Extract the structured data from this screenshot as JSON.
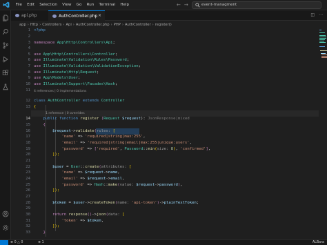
{
  "menu": [
    "File",
    "Edit",
    "Selection",
    "View",
    "Go",
    "Run",
    "Terminal",
    "Help"
  ],
  "search_text": "event-managment",
  "tabs": [
    {
      "label": "api.php",
      "active": false
    },
    {
      "label": "AuthController.php",
      "active": true
    }
  ],
  "breadcrumb": [
    "app",
    "Http",
    "Controllers",
    "Api",
    "AuthController.php",
    "PHP",
    "AuthController",
    "register()"
  ],
  "gutter_numbers": [
    "1",
    "2",
    "3",
    "4",
    "5",
    "6",
    "7",
    "8",
    "9",
    "10",
    "11",
    "12",
    "13",
    "14",
    "15",
    "16",
    "17",
    "18",
    "19",
    "20",
    "21",
    "22",
    "23",
    "24",
    "25",
    "26",
    "27",
    "28",
    "29",
    "30",
    "31",
    "32",
    "33"
  ],
  "codelens": {
    "class_refs": "4 references | 0 implementations",
    "method_refs": "1 reference | 0 overrides"
  },
  "code": {
    "l1": "<?php",
    "l3a": "namespace ",
    "l3b": "App\\Http\\Controllers\\Api",
    "l5": "App\\Http\\Controllers\\Controller",
    "l6": "Illuminate\\Validation\\Rules\\Password",
    "l7": "Illuminate\\Validation\\ValidationException",
    "l8": "Illuminate\\Http\\Request",
    "l9": "App\\Models\\User",
    "l10": "Illuminate\\Support\\Facades\\Hash",
    "use_kw": "use ",
    "l12a": "class ",
    "l12b": "AuthController ",
    "l12c": "extends ",
    "l12d": "Controller",
    "l13": "{",
    "l14a": "public ",
    "l14b": "function ",
    "l14c": "register ",
    "l14d": "(",
    "l14e": "Request ",
    "l14f": "$request",
    "l14g": "): ",
    "l14h": "JsonResponse|mixed",
    "l16a": "$request",
    "l16b": "->",
    "l16c": "validate",
    "l16d": "rules: ",
    "l16e": "[",
    "l17a": "'name' ",
    "l17b": "=> ",
    "l17c": "'required|string|max:255'",
    "l18a": "'email' ",
    "l18b": "=> ",
    "l18c": "'required|string|email|max:255|unique:users'",
    "l19a": "'password' ",
    "l19b": "=> ",
    "l19c": "'required'",
    "l19d": "Password",
    "l19e": "min",
    "l19f": "size: ",
    "l19g": "8",
    "l19h": "'confirmed'",
    "l20": "]);",
    "l22a": "$user ",
    "l22b": "= ",
    "l22c": "User",
    "l22d": "create",
    "l22e": "attributes: ",
    "l22f": "[",
    "l23a": "'name' ",
    "l23b": "=> ",
    "l23c": "$request",
    "l23d": "name",
    "l24a": "'email' ",
    "l24b": "=> ",
    "l24c": "$request",
    "l24d": "email",
    "l25a": "'password' ",
    "l25b": "=> ",
    "l25c": "Hash",
    "l25d": "make",
    "l25e": "value: ",
    "l25f": "$request",
    "l25g": "password",
    "l26": "]);",
    "l28a": "$token ",
    "l28b": "= ",
    "l28c": "$user",
    "l28d": "createToken",
    "l28e": "name: ",
    "l28f": "'api-token'",
    "l28g": "plainTextToken",
    "l30a": "return ",
    "l30b": "response",
    "l30c": "json",
    "l30d": "data: ",
    "l30e": "[",
    "l31a": "'token' ",
    "l31b": "=> ",
    "l31c": "$token",
    "l32": "]);",
    "l33": "}"
  },
  "status": {
    "errors": "0",
    "warnings": "0",
    "remote": "1",
    "right": "ALBara"
  },
  "colors": {
    "accent": "#0078d4",
    "editor_bg": "#1f1f1f"
  }
}
